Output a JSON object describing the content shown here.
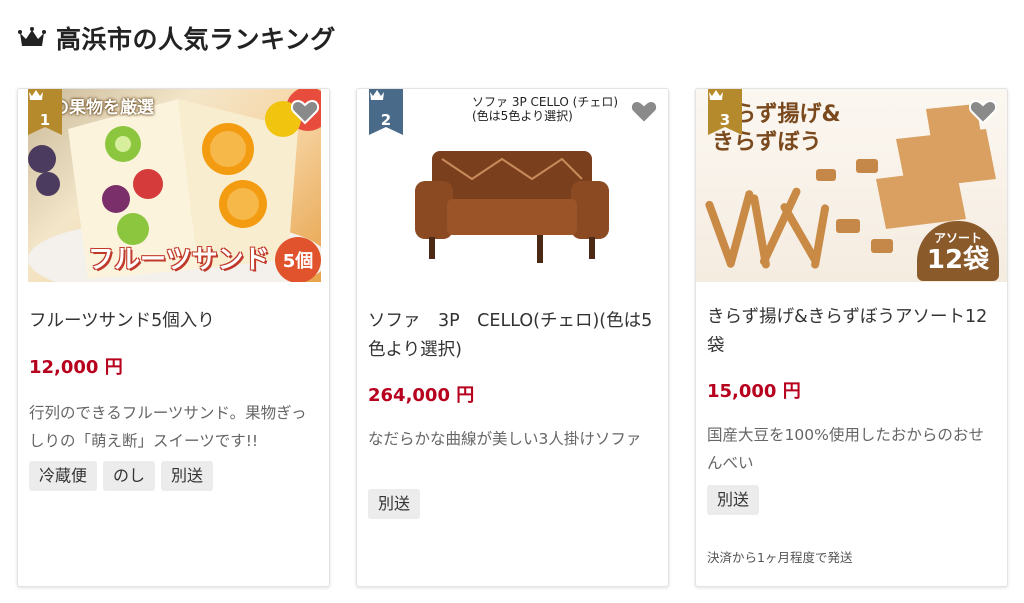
{
  "header": {
    "title": "高浜市の人気ランキング",
    "icon": "crown-icon"
  },
  "colors": {
    "price": "#b7001e",
    "rank_ribbon": "#b48a2c",
    "rank_ribbon_2": "#4a6a8a",
    "tag_bg": "#ececec"
  },
  "products": [
    {
      "rank": "1",
      "image_texts": {
        "top": "の果物を厳選",
        "name": "フルーツサンド",
        "count": "5個"
      },
      "name": "フルーツサンド5個入り",
      "price": "12,000 円",
      "description": "行列のできるフルーツサンド。果物ぎっしりの「萌え断」スイーツです!!",
      "tags": [
        "冷蔵便",
        "のし",
        "別送"
      ]
    },
    {
      "rank": "2",
      "image_texts": {
        "caption": "ソファ 3P CELLO (チェロ)\n(色は5色より選択)"
      },
      "name": "ソファ　3P　CELLO(チェロ)(色は5色より選択)",
      "price": "264,000 円",
      "description": "なだらかな曲線が美しい3人掛けソファ",
      "tags": [
        "別送"
      ]
    },
    {
      "rank": "3",
      "image_texts": {
        "caption": "きらず揚げ&\nきらずぼう",
        "badge_top": "アソート",
        "badge_main": "12袋"
      },
      "name": "きらず揚げ&きらずぼうアソート12袋",
      "price": "15,000 円",
      "description": "国産大豆を100%使用したおからのおせんべい",
      "tags": [
        "別送"
      ],
      "shipping_note": "決済から1ヶ月程度で発送"
    }
  ]
}
